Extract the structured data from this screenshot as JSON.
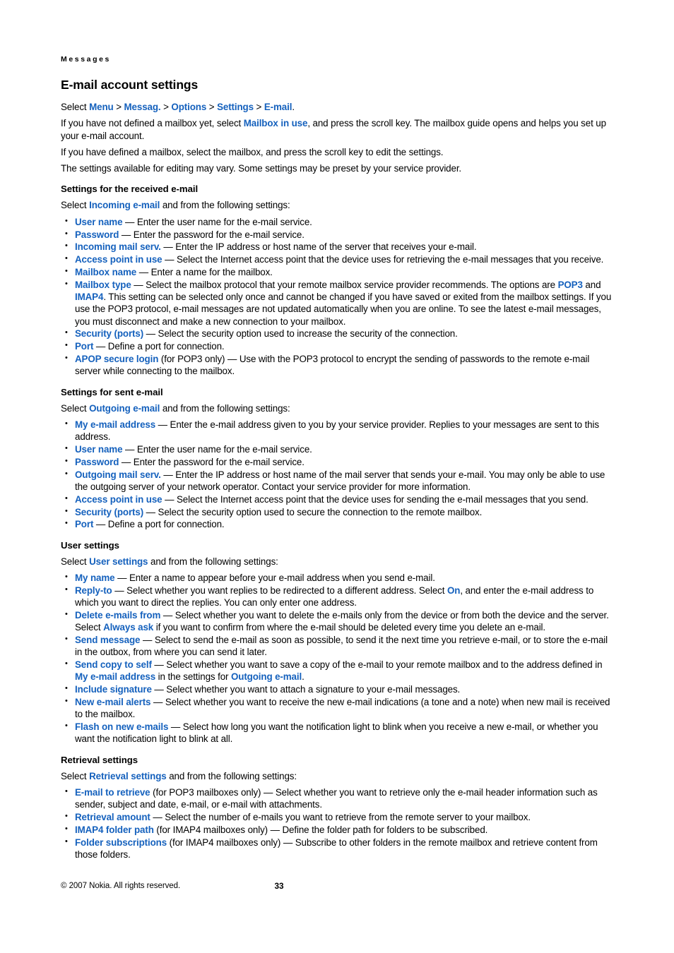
{
  "page": {
    "running_head": "Messages",
    "title": "E-mail account settings",
    "number": "33",
    "copyright": "© 2007 Nokia. All rights reserved.",
    "link_color": "#1561bd",
    "text_color": "#000000",
    "background_color": "#ffffff"
  },
  "intro": {
    "select_path_prefix": "Select ",
    "breadcrumb": [
      "Menu",
      "Messag.",
      "Options",
      "Settings",
      "E-mail"
    ],
    "breadcrumb_separator": ">",
    "breadcrumb_trailing": ".",
    "para_mailbox_in_use_a": "If you have not defined a mailbox yet, select ",
    "para_mailbox_in_use_link": "Mailbox in use",
    "para_mailbox_in_use_b": ", and press the scroll key. The mailbox guide opens and helps you set up your e-mail account.",
    "para_defined_mailbox": "If you have defined a mailbox, select the mailbox, and press the scroll key to edit the settings.",
    "para_vary": "The settings available for editing may vary. Some settings may be preset by your service provider."
  },
  "sections": [
    {
      "heading": "Settings for the received e-mail",
      "select_prefix": "Select ",
      "select_link": "Incoming e-mail",
      "select_suffix": " and from the following settings:",
      "items": [
        {
          "term": "User name",
          "body": " — Enter the user name for the e-mail service."
        },
        {
          "term": "Password",
          "body": " — Enter the password for the e-mail service."
        },
        {
          "term": "Incoming mail serv.",
          "body": " — Enter the IP address or host name of the server that receives your e-mail."
        },
        {
          "term": "Access point in use",
          "body": " — Select the Internet access point that the device uses for retrieving the e-mail messages that you receive."
        },
        {
          "term": "Mailbox name",
          "body": " — Enter a name for the mailbox."
        },
        {
          "term": "Mailbox type",
          "body": " — Select the mailbox protocol that your remote mailbox service provider recommends. The options are ",
          "inline_link_1": "POP3",
          "body_2": " and ",
          "inline_link_2": "IMAP4",
          "body_3": ". This setting can be selected only once and cannot be changed if you have saved or exited from the mailbox settings. If you use the POP3 protocol, e-mail messages are not updated automatically when you are online. To see the latest e-mail messages, you must disconnect and make a new connection to your mailbox."
        },
        {
          "term": "Security (ports)",
          "body": " — Select the security option used to increase the security of the connection."
        },
        {
          "term": "Port",
          "body": " — Define a port for connection."
        },
        {
          "term": "APOP secure login",
          "body": " (for POP3 only) — Use with the POP3 protocol to encrypt the sending of passwords to the remote e-mail server while connecting to the mailbox."
        }
      ]
    },
    {
      "heading": "Settings for sent e-mail",
      "select_prefix": "Select ",
      "select_link": "Outgoing e-mail",
      "select_suffix": " and from the following settings:",
      "items": [
        {
          "term": "My e-mail address",
          "body": " — Enter the e-mail address given to you by your service provider. Replies to your messages are sent to this address."
        },
        {
          "term": "User name",
          "body": " — Enter the user name for the e-mail service."
        },
        {
          "term": "Password",
          "body": " — Enter the password for the e-mail service."
        },
        {
          "term": "Outgoing mail serv.",
          "body": " — Enter the IP address or host name of the mail server that sends your e-mail. You may only be able to use the outgoing server of your network operator. Contact your service provider for more information."
        },
        {
          "term": "Access point in use",
          "body": " — Select the Internet access point that the device uses for sending the e-mail messages that you send."
        },
        {
          "term": "Security (ports)",
          "body": " — Select the security option used to secure the connection to the remote mailbox."
        },
        {
          "term": "Port",
          "body": " — Define a port for connection."
        }
      ]
    },
    {
      "heading": "User settings",
      "select_prefix": "Select ",
      "select_link": "User settings",
      "select_suffix": " and from the following settings:",
      "items": [
        {
          "term": "My name",
          "body": " — Enter a name to appear before your e-mail address when you send e-mail."
        },
        {
          "term": "Reply-to",
          "body": " — Select whether you want replies to be redirected to a different address. Select ",
          "inline_link_1": "On",
          "body_2": ", and enter the e-mail address to which you want to direct the replies. You can only enter one address."
        },
        {
          "term": "Delete e-mails from",
          "body": " — Select whether you want to delete the e-mails only from the device or from both the device and the server. Select ",
          "inline_link_1": "Always ask",
          "body_2": " if you want to confirm from where the e-mail should be deleted every time you delete an e-mail."
        },
        {
          "term": "Send message",
          "body": " — Select to send the e-mail as soon as possible, to send it the next time you retrieve e-mail, or to store the e-mail in the outbox, from where you can send it later."
        },
        {
          "term": "Send copy to self",
          "body": " — Select whether you want to save a copy of the e-mail to your remote mailbox and to the address defined in ",
          "inline_link_1": "My e-mail address",
          "body_2": " in the settings for ",
          "inline_link_2": "Outgoing e-mail",
          "body_3": "."
        },
        {
          "term": "Include signature",
          "body": " — Select whether you want to attach a signature to your e-mail messages."
        },
        {
          "term": "New e-mail alerts",
          "body": " — Select whether you want to receive the new e-mail indications (a tone and a note) when new mail is received to the mailbox."
        },
        {
          "term": "Flash on new e-mails",
          "body": " — Select how long you want the notification light to blink when you receive a new e-mail, or whether you want the notification light to blink at all."
        }
      ]
    },
    {
      "heading": "Retrieval settings",
      "select_prefix": "Select ",
      "select_link": "Retrieval settings",
      "select_suffix": " and from the following settings:",
      "items": [
        {
          "term": "E-mail to retrieve",
          "body": " (for POP3 mailboxes only) — Select whether you want to retrieve only the e-mail header information such as sender, subject and date, e-mail, or e-mail with attachments."
        },
        {
          "term": "Retrieval amount",
          "body": " — Select the number of e-mails you want to retrieve from the remote server to your mailbox."
        },
        {
          "term": "IMAP4 folder path",
          "body": " (for IMAP4 mailboxes only) — Define the folder path for folders to be subscribed."
        },
        {
          "term": "Folder subscriptions",
          "body": " (for IMAP4 mailboxes only) — Subscribe to other folders in the remote mailbox and retrieve content from those folders."
        }
      ]
    }
  ]
}
